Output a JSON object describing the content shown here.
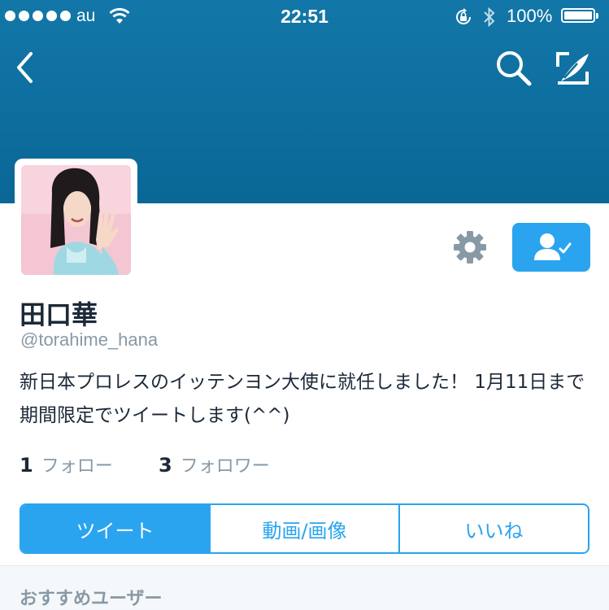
{
  "status_bar": {
    "carrier": "au",
    "time": "22:51",
    "battery": "100%"
  },
  "nav": {
    "icons": [
      "back-icon",
      "search-icon",
      "compose-icon"
    ]
  },
  "profile": {
    "name": "田口華",
    "handle": "@torahime_hana",
    "bio": "新日本プロレスのイッテンヨン大使に就任しました！ 1月11日まで期間限定でツイートします(^^)",
    "following_count": "1",
    "following_label": "フォロー",
    "followers_count": "3",
    "followers_label": "フォロワー"
  },
  "tabs": [
    "ツイート",
    "動画/画像",
    "いいね"
  ],
  "section": {
    "title": "おすすめユーザー"
  },
  "colors": {
    "header": "#0e6f9f",
    "accent": "#2aa4ef",
    "text": "#1c2938",
    "muted": "#8899a6"
  }
}
